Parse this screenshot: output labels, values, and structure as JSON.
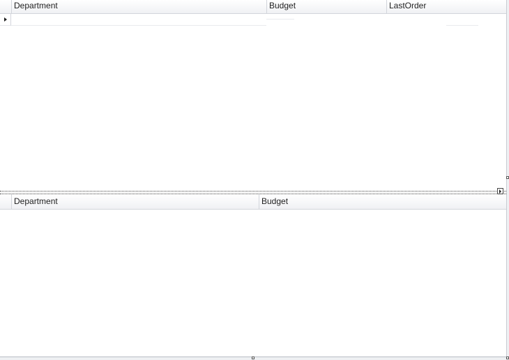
{
  "master_grid": {
    "columns": [
      "Department",
      "Budget",
      "LastOrder"
    ]
  },
  "detail_grid": {
    "columns": [
      "Department",
      "Budget"
    ]
  },
  "icons": {
    "current_row": "row-pointer-icon",
    "expand": "expand-arrow-icon"
  }
}
